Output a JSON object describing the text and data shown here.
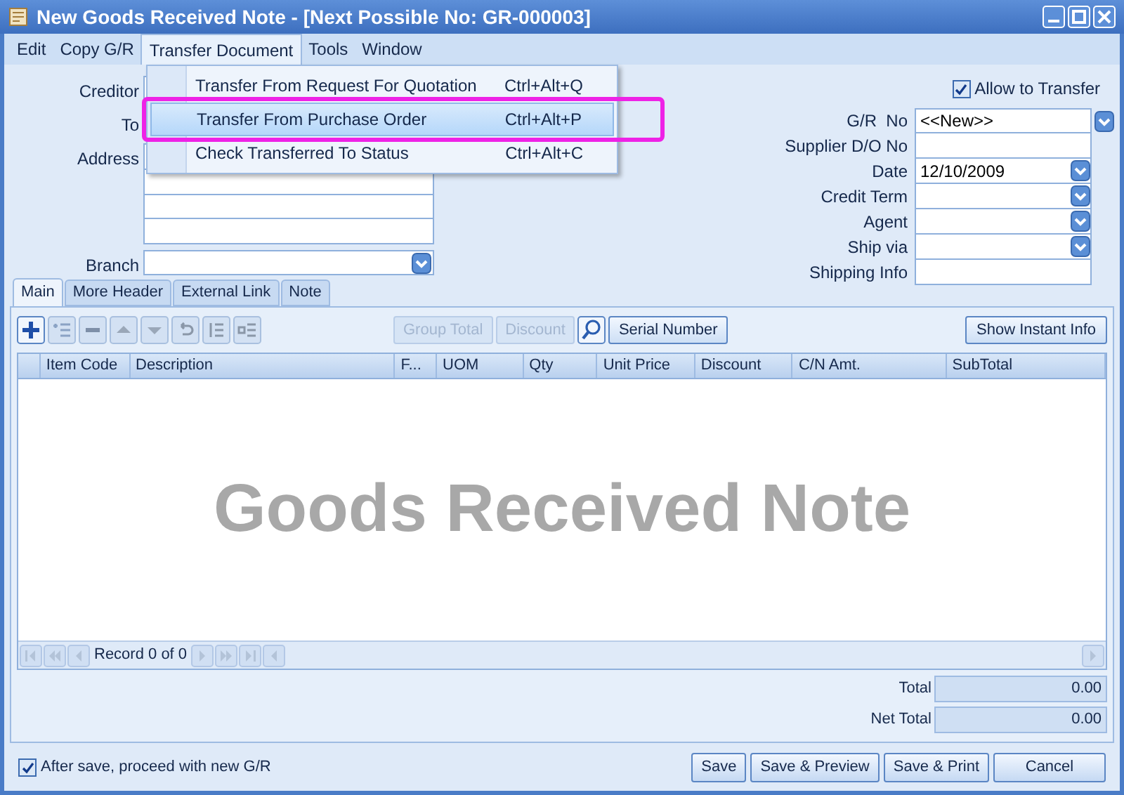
{
  "window": {
    "title": "New Goods Received Note - [Next Possible No: GR-000003]"
  },
  "menu": [
    {
      "label": "Edit",
      "selected": false
    },
    {
      "label": "Copy G/R",
      "selected": false
    },
    {
      "label": "Transfer Document",
      "selected": true
    },
    {
      "label": "Tools",
      "selected": false
    },
    {
      "label": "Window",
      "selected": false
    }
  ],
  "dropdown_menu": [
    {
      "label": "Transfer From Request For Quotation",
      "shortcut": "Ctrl+Alt+Q",
      "selected": false
    },
    {
      "label": "Transfer From Purchase Order",
      "shortcut": "Ctrl+Alt+P",
      "selected": true
    },
    {
      "label": "Check Transferred To Status",
      "shortcut": "Ctrl+Alt+C",
      "selected": false
    }
  ],
  "left_fields": [
    {
      "label": "Creditor",
      "kind": "text"
    },
    {
      "label": "To",
      "kind": "text"
    },
    {
      "label": "Address",
      "kind": "multiline"
    },
    {
      "label": "Branch",
      "kind": "dropdown"
    }
  ],
  "allow_transfer": {
    "label": "Allow to Transfer",
    "checked": true
  },
  "right_fields": [
    {
      "label": "G/R  No",
      "value": "<<New>>",
      "kind": "lookup"
    },
    {
      "label": "Supplier D/O No",
      "kind": "text"
    },
    {
      "label": "Date",
      "value": "12/10/2009",
      "kind": "dropdown"
    },
    {
      "label": "Credit Term",
      "kind": "dropdown"
    },
    {
      "label": "Agent",
      "kind": "dropdown"
    },
    {
      "label": "Ship via",
      "kind": "dropdown"
    },
    {
      "label": "Shipping Info",
      "kind": "text"
    }
  ],
  "tabs": [
    {
      "label": "Main",
      "selected": true
    },
    {
      "label": "More Header",
      "selected": false
    },
    {
      "label": "External Link",
      "selected": false
    },
    {
      "label": "Note",
      "selected": false
    }
  ],
  "toolbar": {
    "buttons": [
      {
        "label": "Group Total",
        "disabled": true
      },
      {
        "label": "Discount",
        "disabled": true
      },
      {
        "label": "Serial Number",
        "disabled": false
      }
    ],
    "instant_info": "Show Instant Info"
  },
  "table": {
    "columns": [
      "Item Code",
      "Description",
      "F...",
      "UOM",
      "Qty",
      "Unit Price",
      "Discount",
      "C/N Amt.",
      "SubTotal"
    ]
  },
  "watermark": "Goods Received Note",
  "navigator": "Record 0 of 0",
  "totals": [
    {
      "label": "Total",
      "value": "0.00"
    },
    {
      "label": "Net Total",
      "value": "0.00"
    }
  ],
  "footer": {
    "proceed": {
      "label": "After save, proceed with new G/R",
      "checked": true
    },
    "buttons": [
      "Save",
      "Save & Preview",
      "Save & Print",
      "Cancel"
    ]
  }
}
